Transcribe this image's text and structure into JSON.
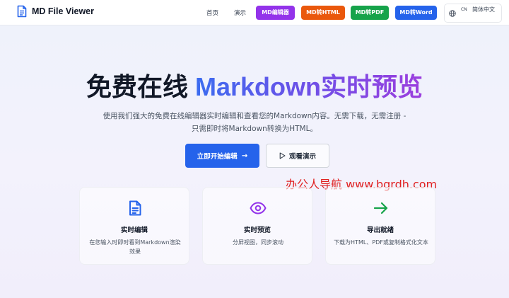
{
  "header": {
    "app_name": "MD File Viewer",
    "nav": {
      "home": "首页",
      "demo": "演示"
    },
    "pills": [
      {
        "label": "MD编辑器",
        "color": "#9333ea"
      },
      {
        "label": "MD转HTML",
        "color": "#ea580c"
      },
      {
        "label": "MD转PDF",
        "color": "#16a34a"
      },
      {
        "label": "MD转Word",
        "color": "#2563eb"
      }
    ],
    "language": {
      "code": "CN",
      "name": "简体中文"
    }
  },
  "hero": {
    "title_plain": "免费在线 ",
    "title_highlight": "Markdown实时预览",
    "description": "使用我们强大的免费在线编辑器实时编辑和查看您的Markdown内容。无需下载，无需注册 - 只需即时将Markdown转换为HTML。",
    "primary_button": "立即开始编辑",
    "primary_arrow": "→",
    "secondary_button": "观看演示"
  },
  "watermark": "办公人导航  www.bgrdh.com",
  "features": [
    {
      "icon": "document-icon",
      "title": "实时编辑",
      "desc": "在您输入时即时看到Markdown渲染效果",
      "color": "#2563eb"
    },
    {
      "icon": "eye-icon",
      "title": "实时预览",
      "desc": "分屏视图，同步滚动",
      "color": "#9333ea"
    },
    {
      "icon": "arrow-right-icon",
      "title": "导出就绪",
      "desc": "下载为HTML、PDF或复制格式化文本",
      "color": "#16a34a"
    }
  ]
}
